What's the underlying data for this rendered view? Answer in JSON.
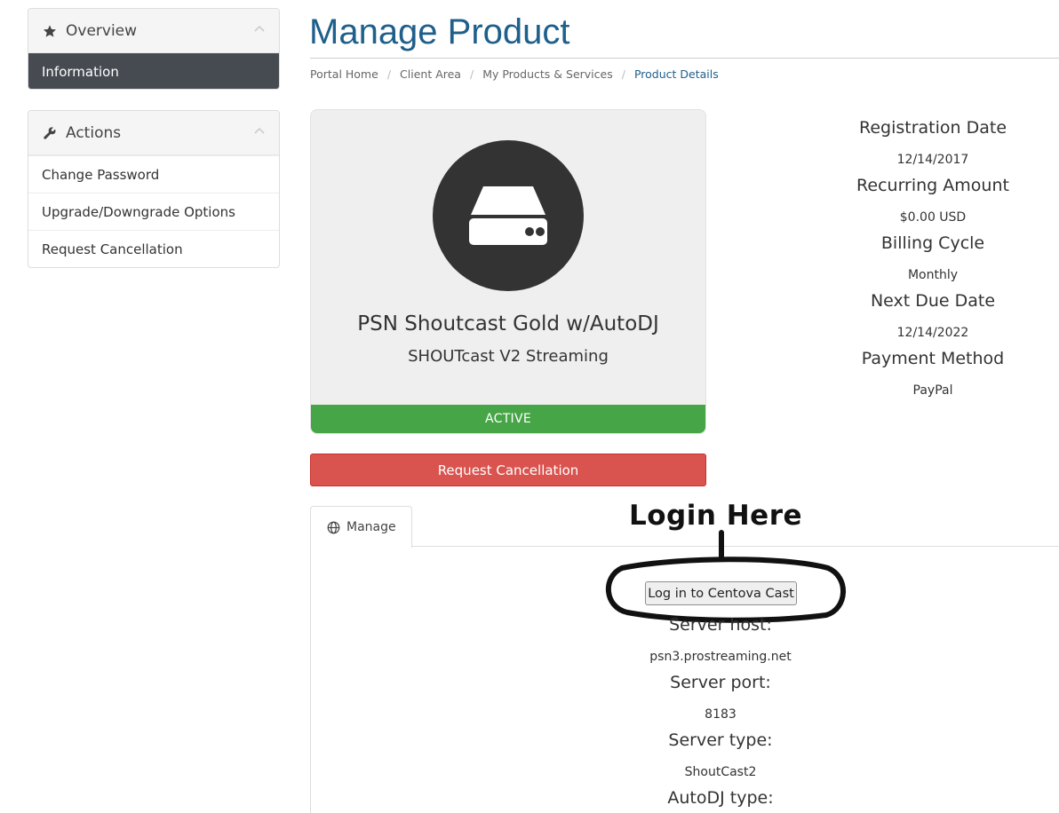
{
  "sidebar": {
    "overview": {
      "title": "Overview",
      "icon": "star-icon",
      "items": [
        "Information"
      ]
    },
    "actions": {
      "title": "Actions",
      "icon": "wrench-icon",
      "items": [
        "Change Password",
        "Upgrade/Downgrade Options",
        "Request Cancellation"
      ]
    }
  },
  "header": {
    "title": "Manage Product",
    "breadcrumb": [
      "Portal Home",
      "Client Area",
      "My Products & Services",
      "Product Details"
    ]
  },
  "product": {
    "icon": "server-icon",
    "name": "PSN Shoutcast Gold w/AutoDJ",
    "subtitle": "SHOUTcast V2 Streaming",
    "status": "ACTIVE",
    "cancel_label": "Request Cancellation"
  },
  "info": [
    {
      "label": "Registration Date",
      "value": "12/14/2017"
    },
    {
      "label": "Recurring Amount",
      "value": "$0.00 USD"
    },
    {
      "label": "Billing Cycle",
      "value": "Monthly"
    },
    {
      "label": "Next Due Date",
      "value": "12/14/2022"
    },
    {
      "label": "Payment Method",
      "value": "PayPal"
    }
  ],
  "tabs": [
    {
      "label": "Manage",
      "icon": "globe-icon"
    }
  ],
  "manage": {
    "login_label": "Log in to Centova Cast",
    "details": [
      {
        "label": "Server host:",
        "value": "psn3.prostreaming.net"
      },
      {
        "label": "Server port:",
        "value": "8183"
      },
      {
        "label": "Server type:",
        "value": "ShoutCast2"
      },
      {
        "label": "AutoDJ type:",
        "value": ""
      }
    ]
  },
  "annotation": {
    "text": "Login Here"
  },
  "colors": {
    "title": "#1f5f8b",
    "active_nav": "#464b52",
    "status_active": "#46a546",
    "danger": "#d9534f"
  }
}
